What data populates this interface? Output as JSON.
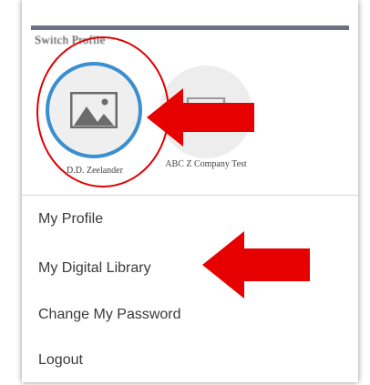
{
  "switch_profile": {
    "title": "Switch Profile",
    "profiles": [
      {
        "name": "D.D. Zeelander",
        "active": true,
        "icon": "image-placeholder-icon"
      },
      {
        "name": "ABC Z Company Test",
        "active": false,
        "icon": "image-placeholder-icon"
      }
    ]
  },
  "menu": {
    "items": [
      {
        "label": "My Profile"
      },
      {
        "label": "My Digital Library"
      },
      {
        "label": "Change My Password"
      },
      {
        "label": "Logout"
      }
    ]
  },
  "annotations": {
    "arrow_color": "#e60000",
    "circle_color": "#e00000",
    "accent_color": "#3a8fd0"
  }
}
